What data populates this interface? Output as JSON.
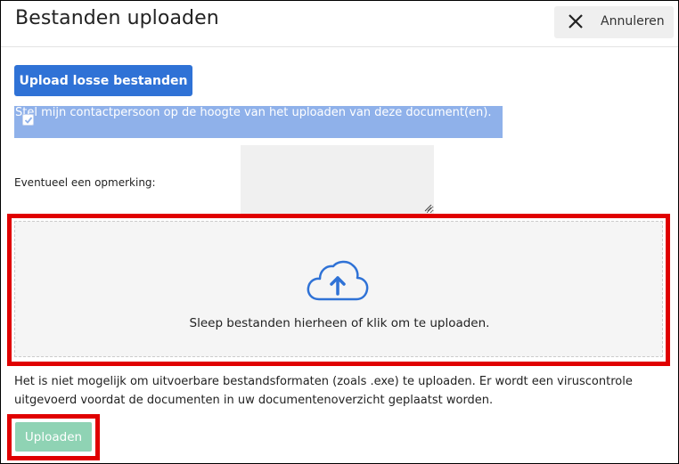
{
  "dialog": {
    "title": "Bestanden uploaden",
    "cancel_label": "Annuleren"
  },
  "form": {
    "upload_single_label": "Upload losse bestanden",
    "notify_label": "Stel mijn contactpersoon op de hoogte van het uploaden van deze document(en).",
    "notify_checked": true,
    "remark_label": "Eventueel een opmerking:",
    "remark_value": ""
  },
  "dropzone": {
    "icon": "cloud-upload-icon",
    "text": "Sleep bestanden hierheen of klik om te uploaden."
  },
  "info": {
    "text": "Het is niet mogelijk om uitvoerbare bestandsformaten (zoals .exe) te uploaden. Er wordt een viruscontrole uitgevoerd voordat de documenten in uw documentenoverzicht geplaatst worden."
  },
  "footer": {
    "upload_label": "Uploaden",
    "upload_enabled": false
  },
  "colors": {
    "primary_button": "#2f72d6",
    "notify_bg": "#8fb1ea",
    "upload_button_disabled": "#8fd3b4",
    "highlight": "#e00000",
    "icon_blue": "#2f72d6"
  }
}
